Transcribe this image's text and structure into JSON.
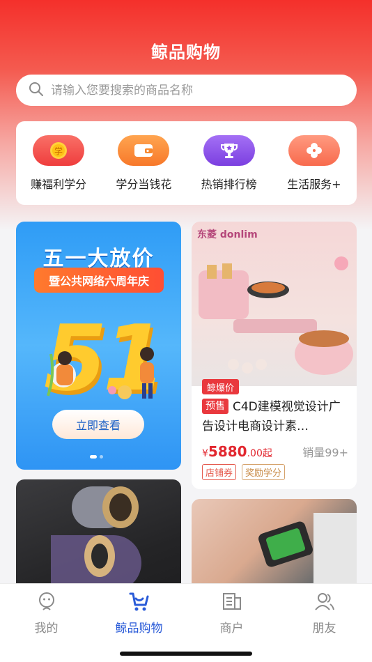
{
  "header": {
    "title": "鲸品购物"
  },
  "search": {
    "placeholder": "请输入您要搜索的商品名称"
  },
  "quick_links": [
    {
      "label": "赚福利学分",
      "icon": "coin-icon",
      "color": "#f4524a"
    },
    {
      "label": "学分当钱花",
      "icon": "wallet-icon",
      "color": "#f9862a"
    },
    {
      "label": "热销排行榜",
      "icon": "trophy-icon",
      "color": "#8b4ce8"
    },
    {
      "label": "生活服务+",
      "icon": "clover-icon",
      "color": "#f8704f"
    }
  ],
  "banner": {
    "title": "五一大放价",
    "subtitle": "暨公共网络六周年庆",
    "big_number": "51",
    "button": "立即查看"
  },
  "product": {
    "brand": "东菱 donlim",
    "hot_tag": "鲸爆价",
    "presale_tag": "预售",
    "title": "C4D建模视觉设计广告设计电商设计素…",
    "currency": "¥",
    "price_int": "5880",
    "price_dec": ".00起",
    "sales": "销量99+",
    "coupons": [
      "店铺券",
      "奖励学分"
    ]
  },
  "tabbar": [
    {
      "label": "我的",
      "icon": "profile-icon",
      "active": false
    },
    {
      "label": "鲸品购物",
      "icon": "shopping-icon",
      "active": true
    },
    {
      "label": "商户",
      "icon": "merchant-icon",
      "active": false
    },
    {
      "label": "朋友",
      "icon": "friends-icon",
      "active": false
    }
  ]
}
